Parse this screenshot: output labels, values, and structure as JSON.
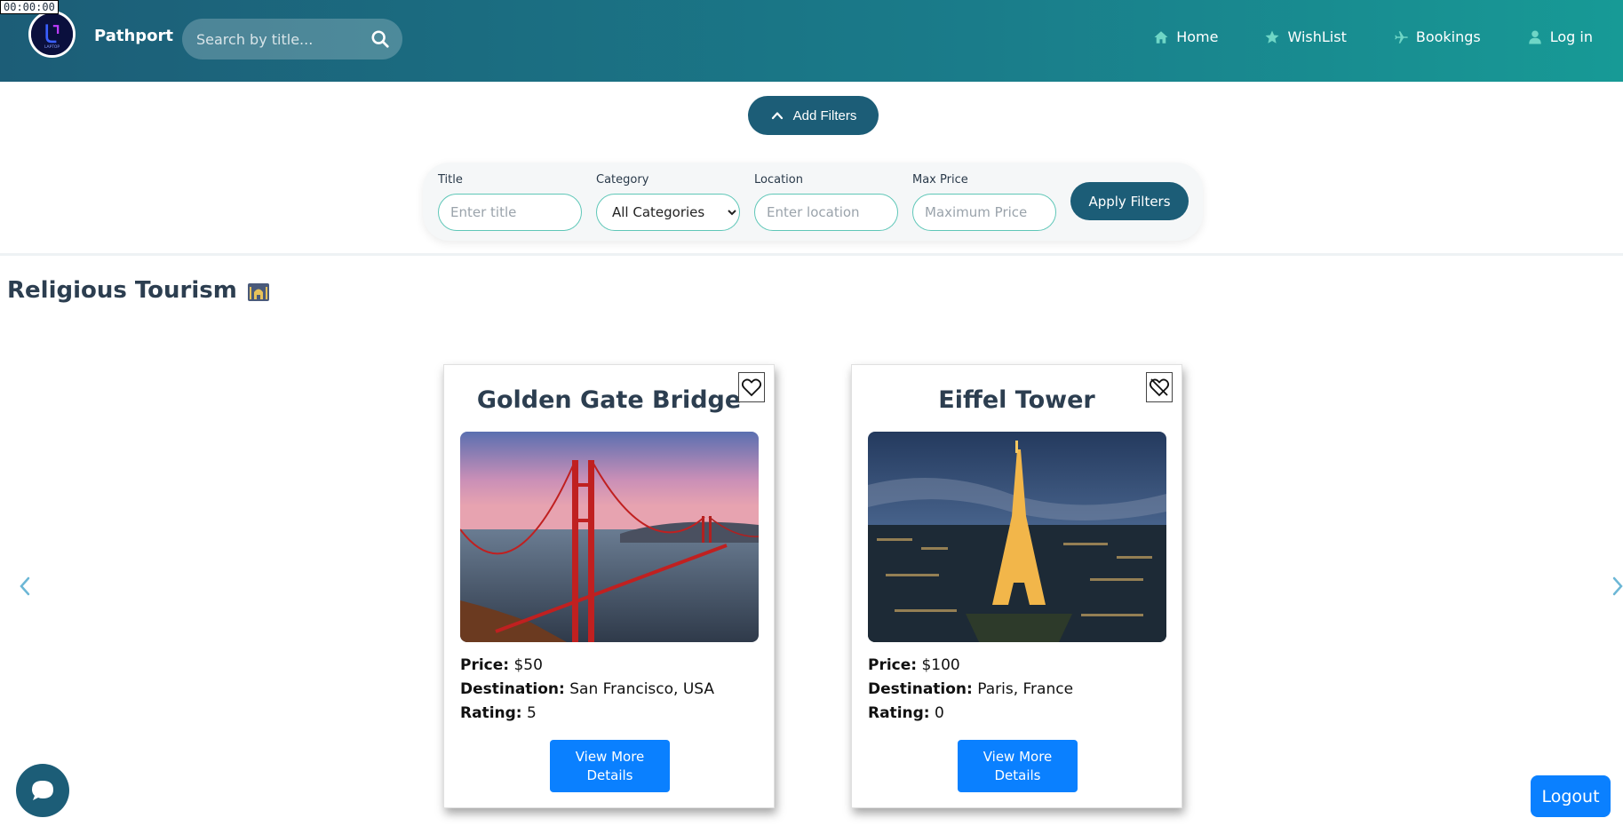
{
  "timer": "00:00:00",
  "navbar": {
    "brand": "Pathport",
    "logo_text": "LAPTOP",
    "search_placeholder": "Search by title...",
    "links": [
      {
        "label": "Home",
        "icon": "home-icon"
      },
      {
        "label": "WishList",
        "icon": "star-icon"
      },
      {
        "label": "Bookings",
        "icon": "plane-icon"
      },
      {
        "label": "Log in",
        "icon": "user-icon"
      }
    ]
  },
  "filters": {
    "toggle_label": "Add Filters",
    "title_label": "Title",
    "title_placeholder": "Enter title",
    "category_label": "Category",
    "category_selected": "All Categories",
    "location_label": "Location",
    "location_placeholder": "Enter location",
    "maxprice_label": "Max Price",
    "maxprice_placeholder": "Maximum Price",
    "apply_label": "Apply Filters"
  },
  "section": {
    "title": "Religious Tourism"
  },
  "labels": {
    "price": "Price:",
    "destination": "Destination:",
    "rating": "Rating:",
    "details": "View More Details"
  },
  "cards": [
    {
      "title": "Golden Gate Bridge",
      "price": "$50",
      "destination": "San Francisco, USA",
      "rating": "5",
      "wishlisted": false
    },
    {
      "title": "Eiffel Tower",
      "price": "$100",
      "destination": "Paris, France",
      "rating": "0",
      "wishlisted": true
    }
  ],
  "logout_label": "Logout",
  "colors": {
    "primary": "#1c5d77",
    "accent": "#0a80ff",
    "input_border": "#5fc7b8"
  }
}
